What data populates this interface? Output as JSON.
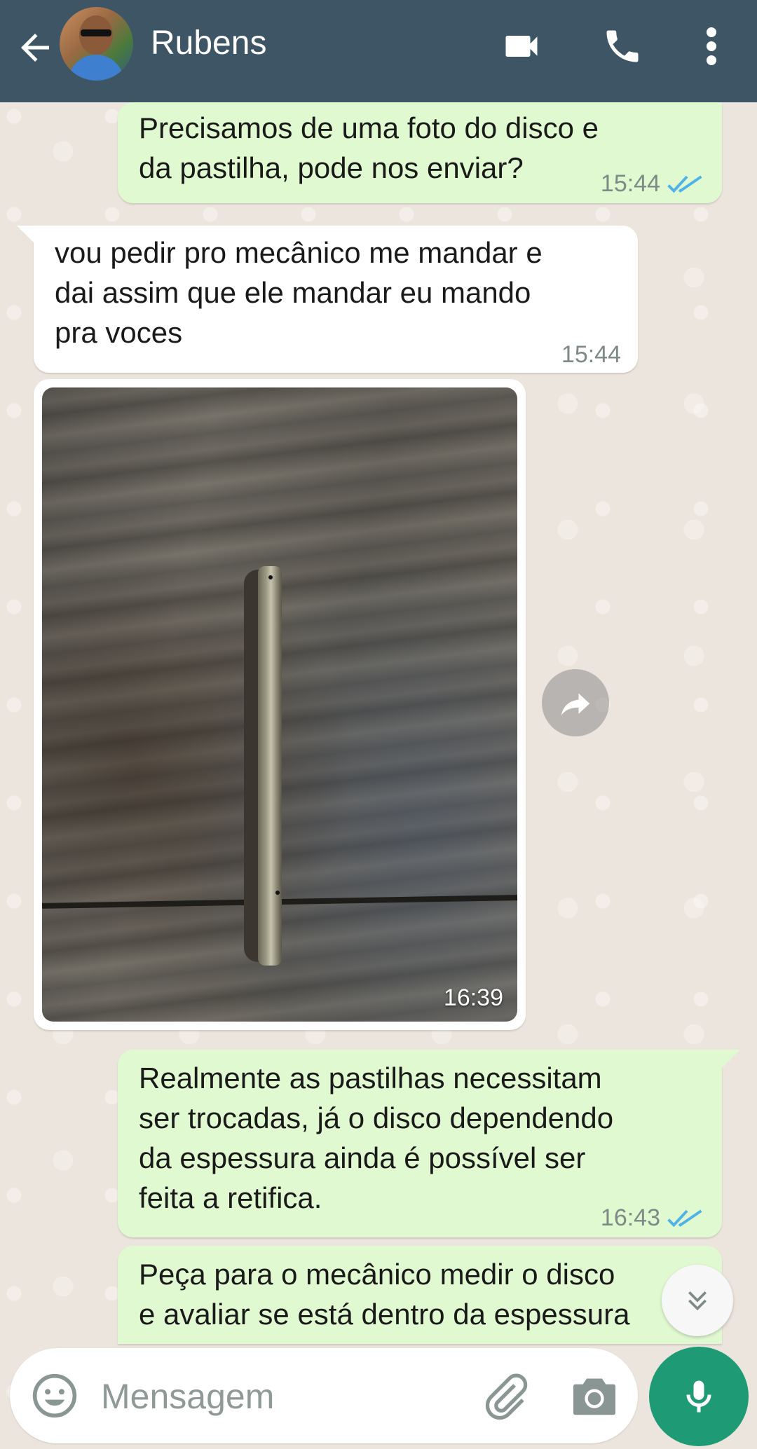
{
  "header": {
    "contact_name": "Rubens",
    "bg_color": "#3d5565",
    "icons": [
      "back-arrow-icon",
      "video-call-icon",
      "voice-call-icon",
      "more-options-icon"
    ]
  },
  "messages": [
    {
      "direction": "outgoing",
      "text": "Precisamos de uma foto do disco e\nda pastilha, pode nos enviar?",
      "time": "15:44",
      "status": "read"
    },
    {
      "direction": "incoming",
      "text": "vou pedir pro mecânico me mandar e\ndai assim que ele mandar eu mando\npra voces",
      "time": "15:44"
    },
    {
      "direction": "incoming",
      "type": "image",
      "time": "16:39"
    },
    {
      "direction": "outgoing",
      "text": "Realmente as pastilhas necessitam\nser trocadas, já o disco dependendo\nda espessura ainda é possível ser\nfeita a retifica.",
      "time": "16:43",
      "status": "read"
    },
    {
      "direction": "outgoing",
      "text": "Peça para o mecânico medir o disco\ne avaliar se está dentro da espessura"
    }
  ],
  "composer": {
    "placeholder": "Mensagem",
    "icons": [
      "emoji-icon",
      "attach-icon",
      "camera-icon",
      "microphone-icon"
    ]
  },
  "colors": {
    "outgoing_bubble": "#e1f9d1",
    "incoming_bubble": "#ffffff",
    "read_ticks": "#4fb3e8",
    "mic_button": "#1e9b74"
  }
}
